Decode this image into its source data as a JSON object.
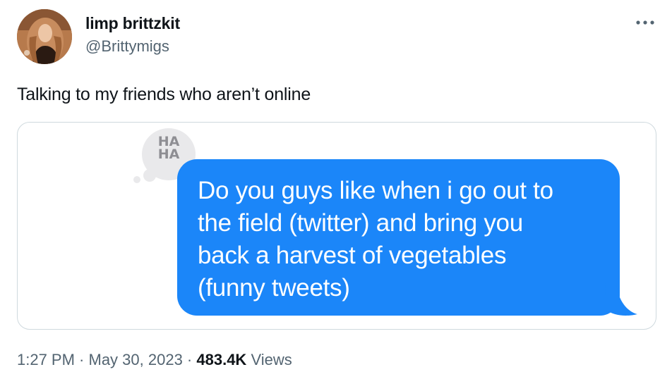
{
  "author": {
    "display_name": "limp brittzkit",
    "handle": "@Brittymigs"
  },
  "more_icon": "more-horizontal-icon",
  "tweet": {
    "text": "Talking to my friends who aren’t online"
  },
  "media": {
    "tapback_line1": "HA",
    "tapback_line2": "HA",
    "message_line1": "Do you guys like when i go out to",
    "message_line2": "the field (twitter) and bring you",
    "message_line3": "back a harvest of vegetables",
    "message_line4": "(funny tweets)",
    "bubble_color": "#1b86f9",
    "tapback_color": "#e9e9eb"
  },
  "meta": {
    "time": "1:27 PM",
    "separator1": " · ",
    "date": "May 30, 2023",
    "separator2": " · ",
    "views_count": "483.4K",
    "views_label": " Views"
  }
}
